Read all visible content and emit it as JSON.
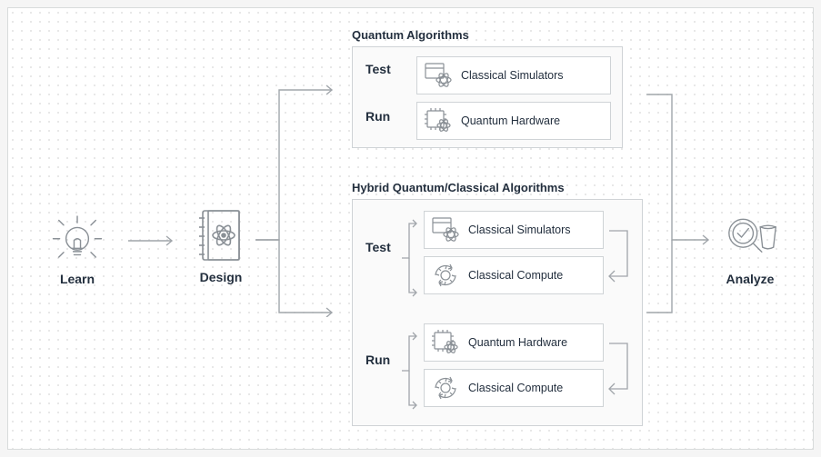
{
  "stages": {
    "learn": "Learn",
    "design": "Design",
    "analyze": "Analyze"
  },
  "quantum_panel": {
    "title": "Quantum Algorithms",
    "test_label": "Test",
    "run_label": "Run",
    "test_item": "Classical Simulators",
    "run_item": "Quantum Hardware"
  },
  "hybrid_panel": {
    "title": "Hybrid Quantum/Classical Algorithms",
    "test_label": "Test",
    "run_label": "Run",
    "test_items": [
      "Classical Simulators",
      "Classical Compute"
    ],
    "run_items": [
      "Quantum Hardware",
      "Classical Compute"
    ]
  }
}
